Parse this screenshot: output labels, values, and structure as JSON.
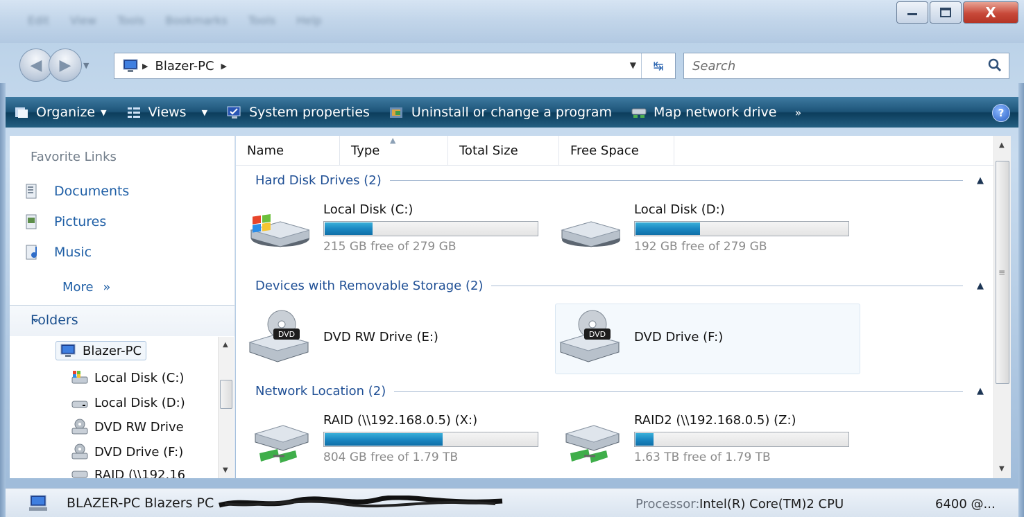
{
  "window": {
    "menu_ghost": [
      "Edit",
      "View",
      "Tools",
      "Bookmarks",
      "Tools",
      "Help"
    ]
  },
  "caption": {
    "minimize": "▭",
    "maximize": "▣",
    "close": "X"
  },
  "address": {
    "crumbs": [
      "Blazer-PC"
    ],
    "search_placeholder": "Search"
  },
  "commands": {
    "organize": "Organize",
    "views": "Views",
    "system_properties": "System properties",
    "uninstall": "Uninstall or change a program",
    "map_drive": "Map network drive",
    "overflow": "»",
    "help": "?"
  },
  "sidebar": {
    "favorites_title": "Favorite Links",
    "favorites": [
      {
        "label": "Documents",
        "icon": "documents-icon"
      },
      {
        "label": "Pictures",
        "icon": "pictures-icon"
      },
      {
        "label": "Music",
        "icon": "music-icon"
      }
    ],
    "more_label": "More",
    "more_chevron": "»",
    "folders_title": "Folders",
    "tree": [
      {
        "label": "Blazer-PC"
      },
      {
        "label": "Local Disk (C:)"
      },
      {
        "label": "Local Disk (D:)"
      },
      {
        "label": "DVD RW Drive"
      },
      {
        "label": "DVD Drive (F:)"
      },
      {
        "label": "RAID (\\\\192.16"
      }
    ]
  },
  "columns": [
    "Name",
    "Type",
    "Total Size",
    "Free Space"
  ],
  "groups": [
    {
      "label": "Hard Disk Drives (2)"
    },
    {
      "label": "Devices with Removable Storage (2)"
    },
    {
      "label": "Network Location (2)"
    }
  ],
  "drives": {
    "c": {
      "name": "Local Disk (C:)",
      "free": "215 GB free of 279 GB",
      "used_fraction": 0.23
    },
    "d": {
      "name": "Local Disk (D:)",
      "free": "192 GB free of 279 GB",
      "used_fraction": 0.31
    },
    "e": {
      "name": "DVD RW Drive (E:)",
      "badge": "DVD"
    },
    "f": {
      "name": "DVD Drive (F:)",
      "badge": "DVD"
    },
    "x": {
      "name": "RAID (\\\\192.168.0.5) (X:)",
      "free": "804 GB free of 1.79 TB",
      "used_fraction": 0.56
    },
    "z": {
      "name": "RAID2 (\\\\192.168.0.5) (Z:)",
      "free": "1.63 TB free of 1.79 TB",
      "used_fraction": 0.09
    }
  },
  "status": {
    "computer_name": "BLAZER-PC Blazers PC",
    "processor_label": "Processor:",
    "processor_value": "Intel(R) Core(TM)2 CPU",
    "processor_value2": "6400 @..."
  }
}
